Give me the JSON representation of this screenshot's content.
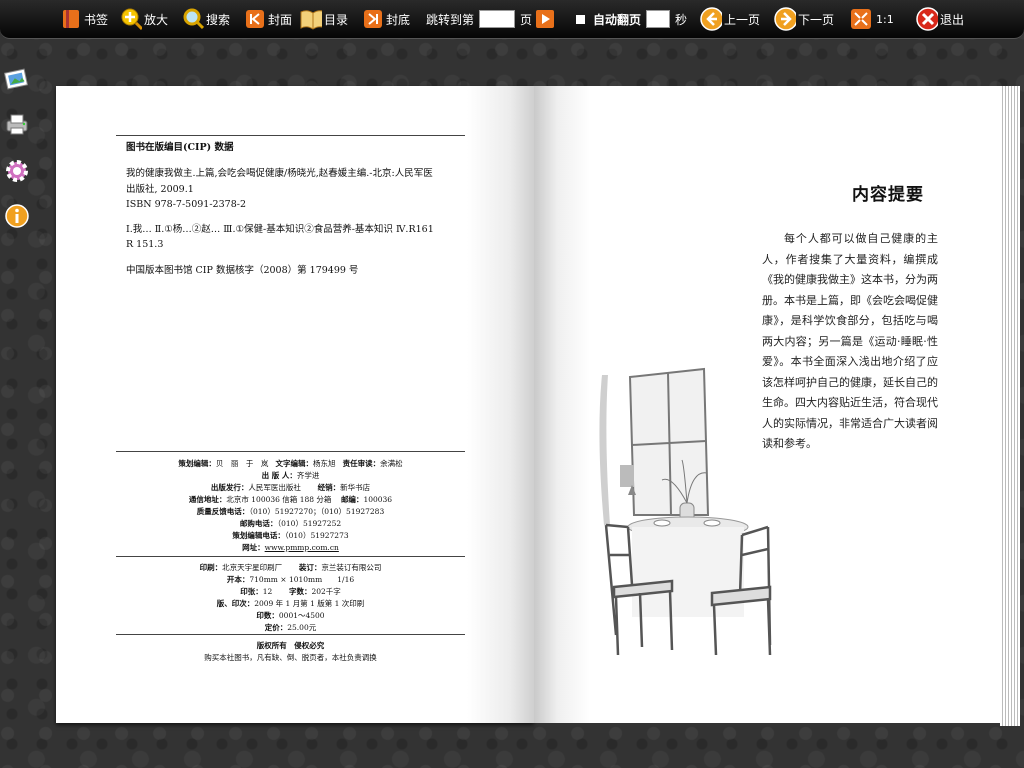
{
  "toolbar": {
    "bookmark": "书签",
    "zoom": "放大",
    "search": "搜索",
    "cover": "封面",
    "toc": "目录",
    "back_cover": "封底",
    "goto_label": "跳转到第",
    "goto_unit": "页",
    "goto_value": "",
    "auto_flip": "自动翻页",
    "auto_flip_unit": "秒",
    "auto_flip_value": "",
    "prev": "上一页",
    "next": "下一页",
    "ratio": "1:1",
    "exit": "退出"
  },
  "left_page": {
    "cip_title": "图书在版编目(CIP) 数据",
    "cip_line1": "我的健康我做主.上篇,会吃会喝促健康/杨晓光,赵春媛主编.-北京:人民军医",
    "cip_line2": "出版社, 2009.1",
    "isbn": "ISBN  978-7-5091-2378-2",
    "classification": "Ⅰ.我…  Ⅱ.①杨…②赵…  Ⅲ.①保健-基本知识②食品营养-基本知识  Ⅳ.R161",
    "classification2": "R 151.3",
    "cip_record": "中国版本图书馆 CIP 数据核字（2008）第 179499 号",
    "credits": {
      "planning_label": "策划编辑：",
      "planning_value": "贝　丽　于　岚",
      "text_editor_label": "文字编辑：",
      "text_editor_value": "杨东旭",
      "proof_label": "责任审读：",
      "proof_value": "余满松",
      "publisher_person_label": "出 版 人：",
      "publisher_person_value": "齐学进",
      "publisher_label": "出版发行：",
      "publisher_value": "人民军医出版社",
      "distributor_label": "经销：",
      "distributor_value": "新华书店",
      "address_label": "通信地址：",
      "address_value": "北京市 100036 信箱 188 分箱",
      "postcode_label": "邮编：",
      "postcode_value": "100036",
      "feedback_label": "质量反馈电话：",
      "feedback_value": "（010）51927270；（010）51927283",
      "mail_order_label": "邮购电话：",
      "mail_order_value": "（010）51927252",
      "planning_phone_label": "策划编辑电话：",
      "planning_phone_value": "（010）51927273",
      "web_label": "网址：",
      "web_value": "www.pmmp.com.cn",
      "print_label": "印刷：",
      "print_value": "北京天宇星印刷厂",
      "binding_label": "装订：",
      "binding_value": "京兰装订有限公司",
      "format_label": "开本：",
      "format_value": "710mm × 1010mm　　1/16",
      "sheets_label": "印张：",
      "sheets_value": "12",
      "words_label": "字数：",
      "words_value": "202千字",
      "edition_label": "版、印次：",
      "edition_value": "2009 年 1 月第 1 版第 1 次印刷",
      "count_label": "印数：",
      "count_value": "0001～4500",
      "price_label": "定价：",
      "price_value": "25.00元",
      "rights_title": "版权所有　侵权必究",
      "rights_note": "购买本社图书，凡有缺、倒、脱页者，本社负责调换"
    }
  },
  "right_page": {
    "title": "内容提要",
    "summary": "每个人都可以做自己健康的主人，作者搜集了大量资料，编撰成《我的健康我做主》这本书，分为两册。本书是上篇，即《会吃会喝促健康》，是科学饮食部分，包括吃与喝两大内容；另一篇是《运动·睡眠·性爱》。本书全面深入浅出地介绍了应该怎样呵护自己的健康，延长自己的生命。四大内容贴近生活，符合现代人的实际情况，非常适合广大读者阅读和参考。"
  }
}
